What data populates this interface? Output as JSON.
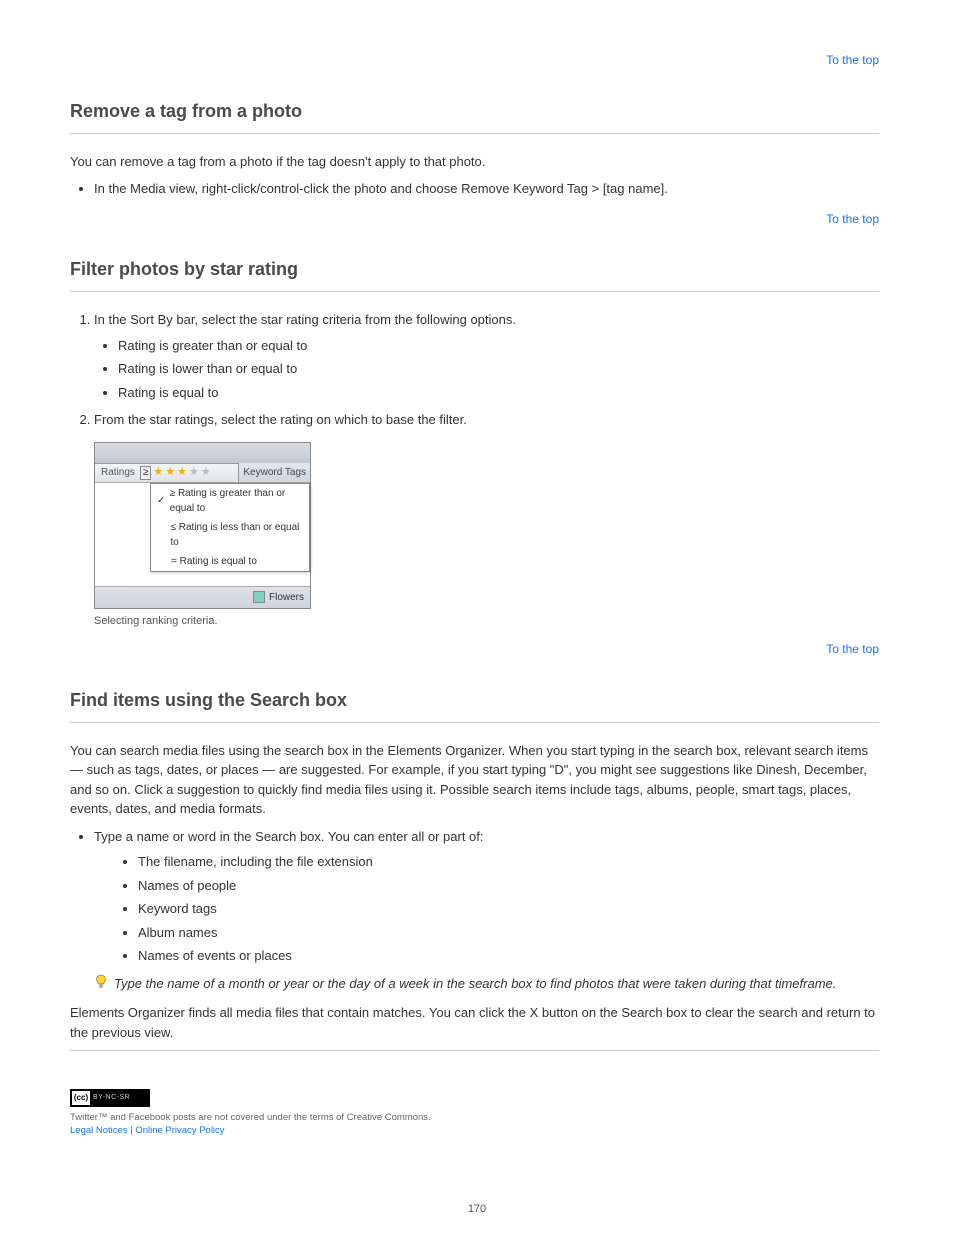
{
  "section_remove": {
    "title": "Remove a tag from a photo",
    "intro": "You can remove a tag from a photo if the tag doesn't apply to that photo.",
    "bullets": [
      "In the Media view, right-click/control-click the photo and choose Remove Keyword Tag > [tag name]."
    ],
    "totop": "To the top"
  },
  "section_filter": {
    "title": "Filter photos by star rating",
    "step1": "In the Sort By bar, select the star rating criteria from the following options.",
    "substeps": [
      "Rating is greater than or equal to",
      "Rating is lower than or equal to",
      "Rating is equal to"
    ],
    "step2": "From the star ratings, select the rating on which to base the filter.",
    "totop": "To the top",
    "figure": {
      "ratings_label": "Ratings",
      "operator": "≥",
      "keyword_tags": "Keyword Tags",
      "dropdown": [
        "Rating is greater than or equal to",
        "Rating is less than or equal to",
        "Rating is equal to"
      ],
      "checked_index": 0,
      "below_item": "Flowers"
    },
    "caption": "Selecting ranking criteria."
  },
  "section_find": {
    "title": "Find items using the Search box",
    "para1": "You can search media files using the search box in the Elements Organizer. When you start typing in the search box, relevant search items — such as tags, dates, or places — are suggested. For example, if you start typing \"D\", you might see suggestions like Dinesh, December, and so on. Click a suggestion to quickly find media files using it. Possible search items include tags, albums, people, smart tags, places, events, dates, and media formats.",
    "step_main": "Type a name or word in the Search box. You can enter all or part of:",
    "sub_bullets": [
      "The filename, including the file extension",
      "Names of people",
      "Keyword tags",
      "Album names",
      "Names of events or places"
    ],
    "tip": "Type the name of a month or year or the day of a week in the search box to find photos that were taken during that timeframe.",
    "para3": "Elements Organizer finds all media files that contain matches. You can click the X button on the Search box to clear the search and return to the previous view.",
    "totop": "To the top"
  },
  "legal": {
    "line1": "Twitter™ and Facebook posts are not covered under the terms of Creative Commons.",
    "line2_a": "Legal Notices",
    "line2_sep": "   |   ",
    "line2_b": "Online Privacy Policy"
  },
  "page_number": "170"
}
